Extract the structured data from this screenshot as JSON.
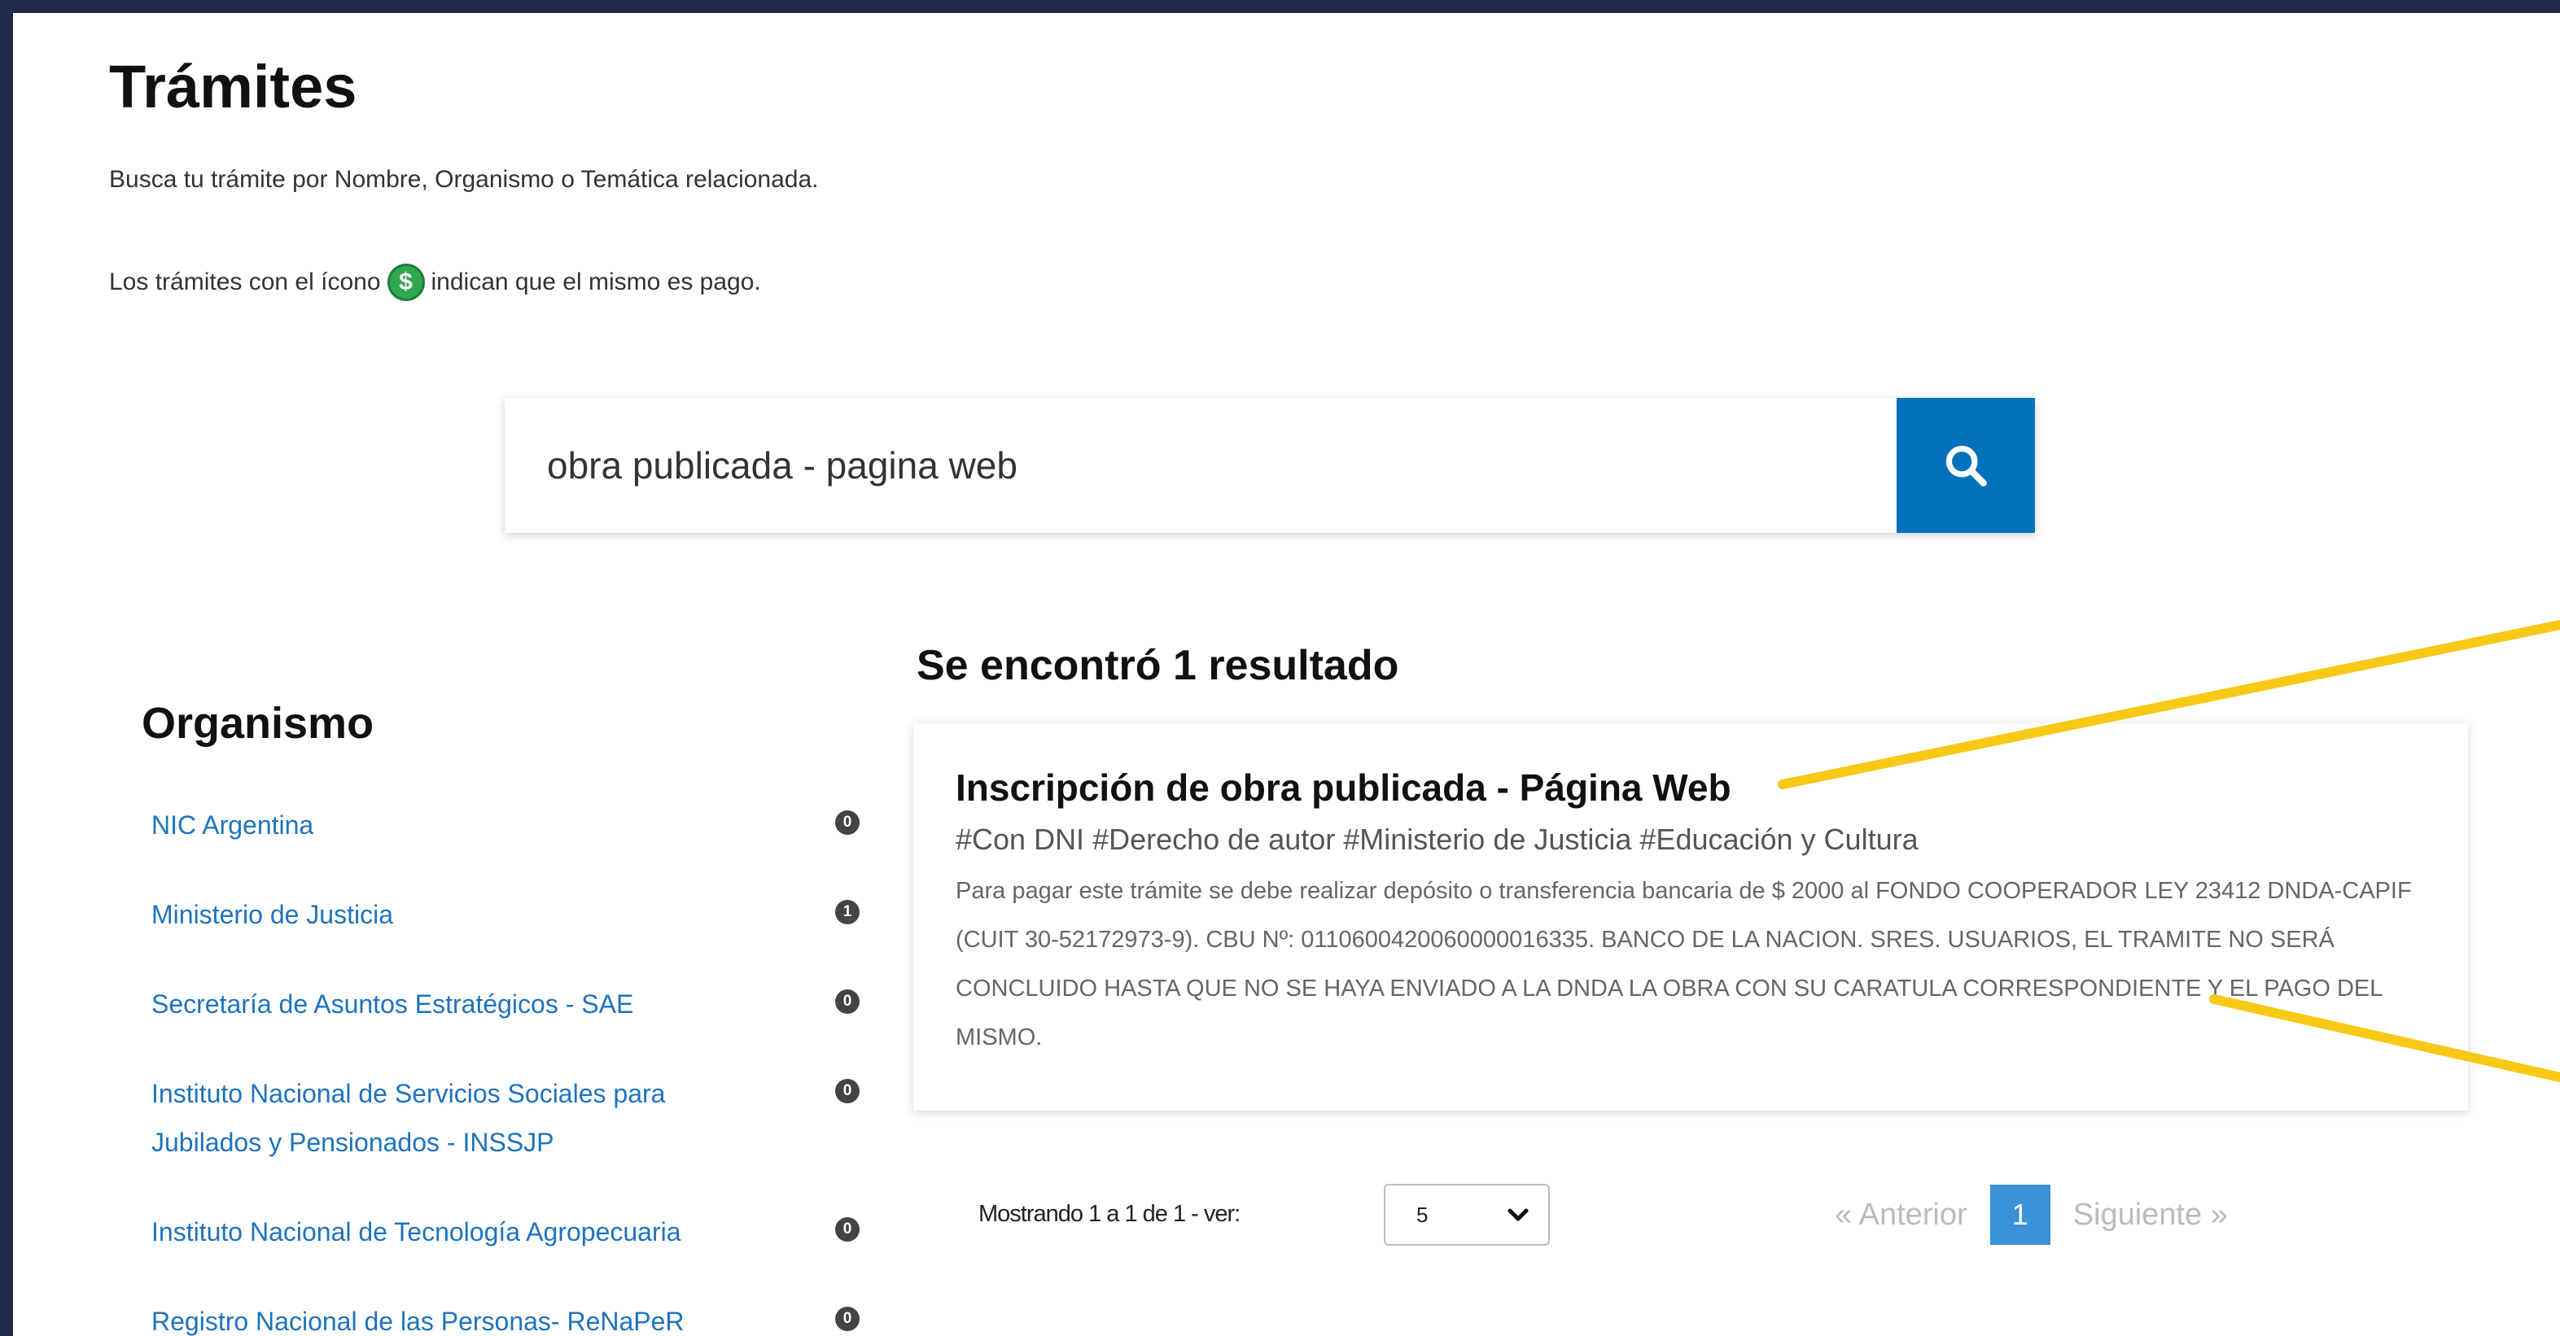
{
  "page": {
    "title": "Trámites",
    "subtitle": "Busca tu trámite por Nombre, Organismo o Temática relacionada.",
    "paid_before": "Los trámites con el ícono",
    "paid_icon": "dollar-icon",
    "paid_icon_glyph": "$",
    "paid_after": "indican que el mismo es pago."
  },
  "search": {
    "value": "obra publicada - pagina web",
    "button_icon": "search-icon"
  },
  "sidebar": {
    "title": "Organismo",
    "items": [
      {
        "label": "NIC Argentina",
        "count": "0"
      },
      {
        "label": "Ministerio de Justicia",
        "count": "1"
      },
      {
        "label": "Secretaría de Asuntos Estratégicos - SAE",
        "count": "0"
      },
      {
        "label": "Instituto Nacional de Servicios Sociales para Jubilados y Pensionados - INSSJP",
        "count": "0"
      },
      {
        "label": "Instituto Nacional de Tecnología Agropecuaria",
        "count": "0"
      },
      {
        "label": "Registro Nacional de las Personas- ReNaPeR",
        "count": "0"
      }
    ]
  },
  "results": {
    "heading": "Se encontró 1 resultado",
    "items": [
      {
        "title": "Inscripción de obra publicada - Página Web",
        "tags": "#Con DNI #Derecho de autor #Ministerio de Justicia #Educación y Cultura",
        "description": "Para pagar este trámite se debe realizar depósito o transferencia bancaria de $ 2000 al FONDO COOPERADOR LEY 23412 DNDA-CAPIF (CUIT 30-52172973-9). CBU Nº: 0110600420060000016335. BANCO DE LA NACION. SRES. USUARIOS, EL TRAMITE NO SERÁ CONCLUIDO HASTA QUE NO SE HAYA ENVIADO A LA DNDA LA OBRA CON SU CARATULA CORRESPONDIENTE Y EL PAGO DEL MISMO."
      }
    ]
  },
  "pagination": {
    "showing": "Mostrando 1 a 1 de 1 - ver:",
    "page_size": "5",
    "prev": "« Anterior",
    "current": "1",
    "next": "Siguiente »"
  },
  "colors": {
    "frame": "#1f2b48",
    "accent": "#0072bb",
    "link": "#1e73be",
    "annotation": "#f6c915",
    "paid_icon": "#2fa84f"
  }
}
